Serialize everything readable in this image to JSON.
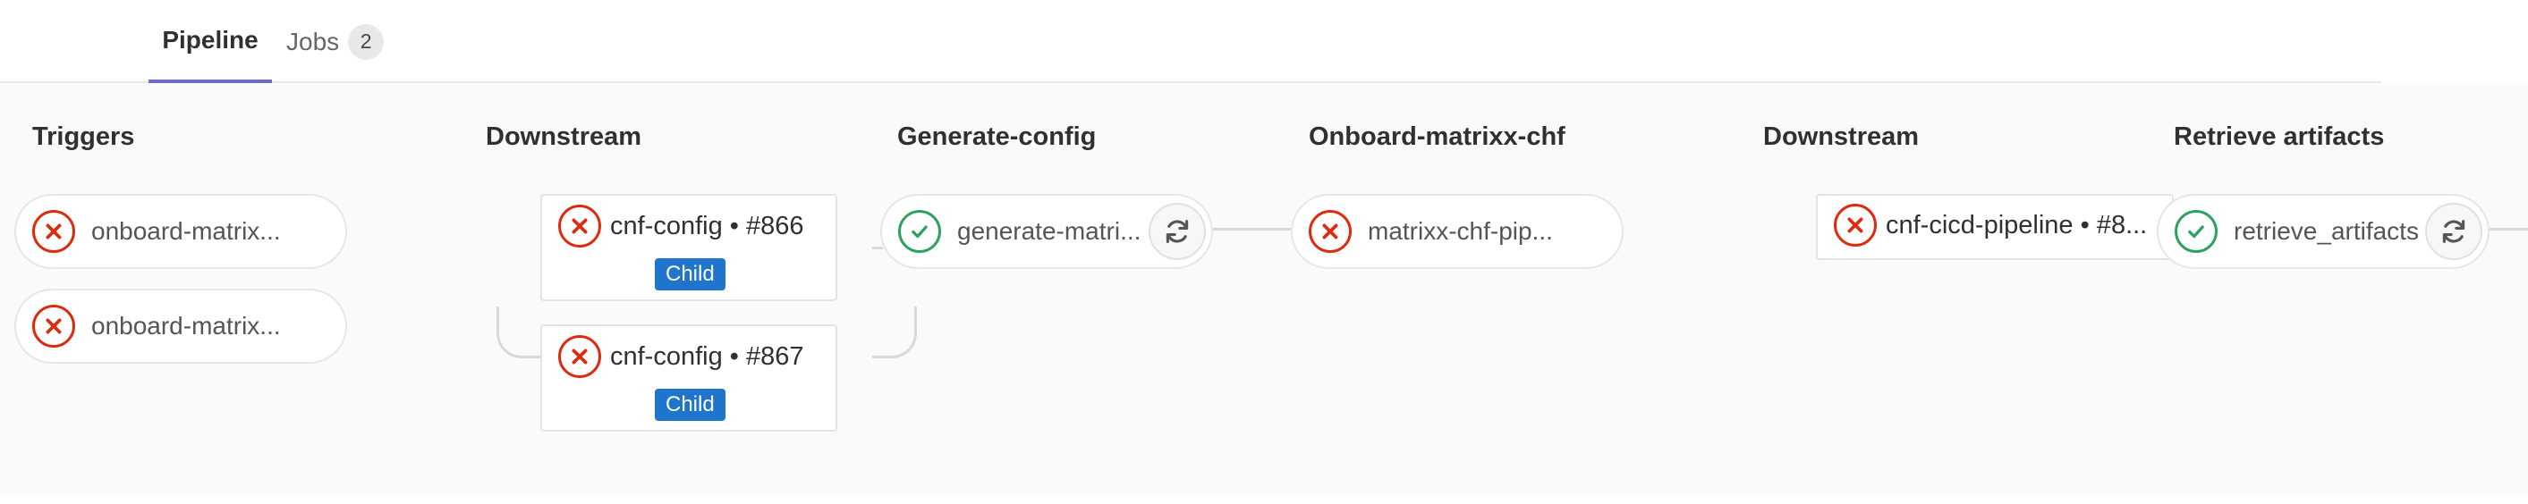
{
  "tabs": {
    "pipeline": "Pipeline",
    "jobs": "Jobs",
    "jobs_count": "2"
  },
  "columns": {
    "triggers": "Triggers",
    "downstream1": "Downstream",
    "generate_config": "Generate-config",
    "onboard": "Onboard-matrixx-chf",
    "downstream2": "Downstream",
    "retrieve": "Retrieve artifacts"
  },
  "jobs": {
    "trigger1": {
      "label": "onboard-matrix...",
      "status": "failed"
    },
    "trigger2": {
      "label": "onboard-matrix...",
      "status": "failed"
    },
    "cnf866": {
      "label": "cnf-config • #866",
      "badge": "Child",
      "status": "failed"
    },
    "cnf867": {
      "label": "cnf-config • #867",
      "badge": "Child",
      "status": "failed"
    },
    "generate": {
      "label": "generate-matri...",
      "status": "success"
    },
    "onboard": {
      "label": "matrixx-chf-pip...",
      "status": "failed"
    },
    "cicd": {
      "label": "cnf-cicd-pipeline • #8...",
      "status": "failed"
    },
    "retrieve": {
      "label": "retrieve_artifacts",
      "status": "success"
    }
  },
  "colors": {
    "failed": "#dd2b0e",
    "success": "#2da160",
    "badge": "#1f75cb",
    "tab_active": "#6b6bd6"
  }
}
